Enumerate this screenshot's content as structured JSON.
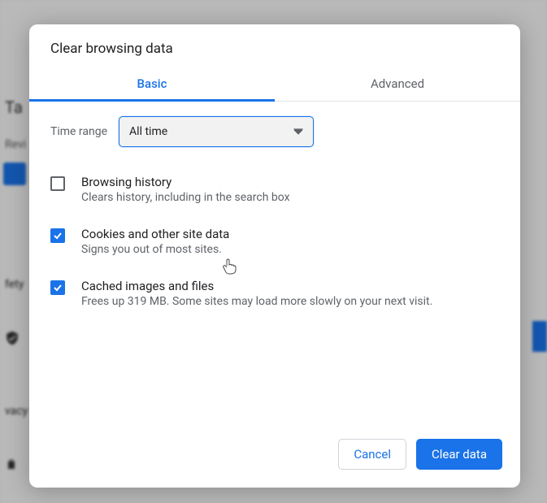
{
  "background": {
    "title_fragment": "Ta",
    "subtext_fragment": "Revi",
    "safety_fragment": "fety",
    "privacy_fragment": "vacy"
  },
  "dialog": {
    "title": "Clear browsing data",
    "tabs": {
      "basic": "Basic",
      "advanced": "Advanced",
      "active": "basic"
    },
    "time_range": {
      "label": "Time range",
      "value": "All time"
    },
    "options": [
      {
        "checked": false,
        "title": "Browsing history",
        "desc": "Clears history, including in the search box"
      },
      {
        "checked": true,
        "title": "Cookies and other site data",
        "desc": "Signs you out of most sites."
      },
      {
        "checked": true,
        "title": "Cached images and files",
        "desc": "Frees up 319 MB. Some sites may load more slowly on your next visit."
      }
    ],
    "buttons": {
      "cancel": "Cancel",
      "confirm": "Clear data"
    }
  }
}
